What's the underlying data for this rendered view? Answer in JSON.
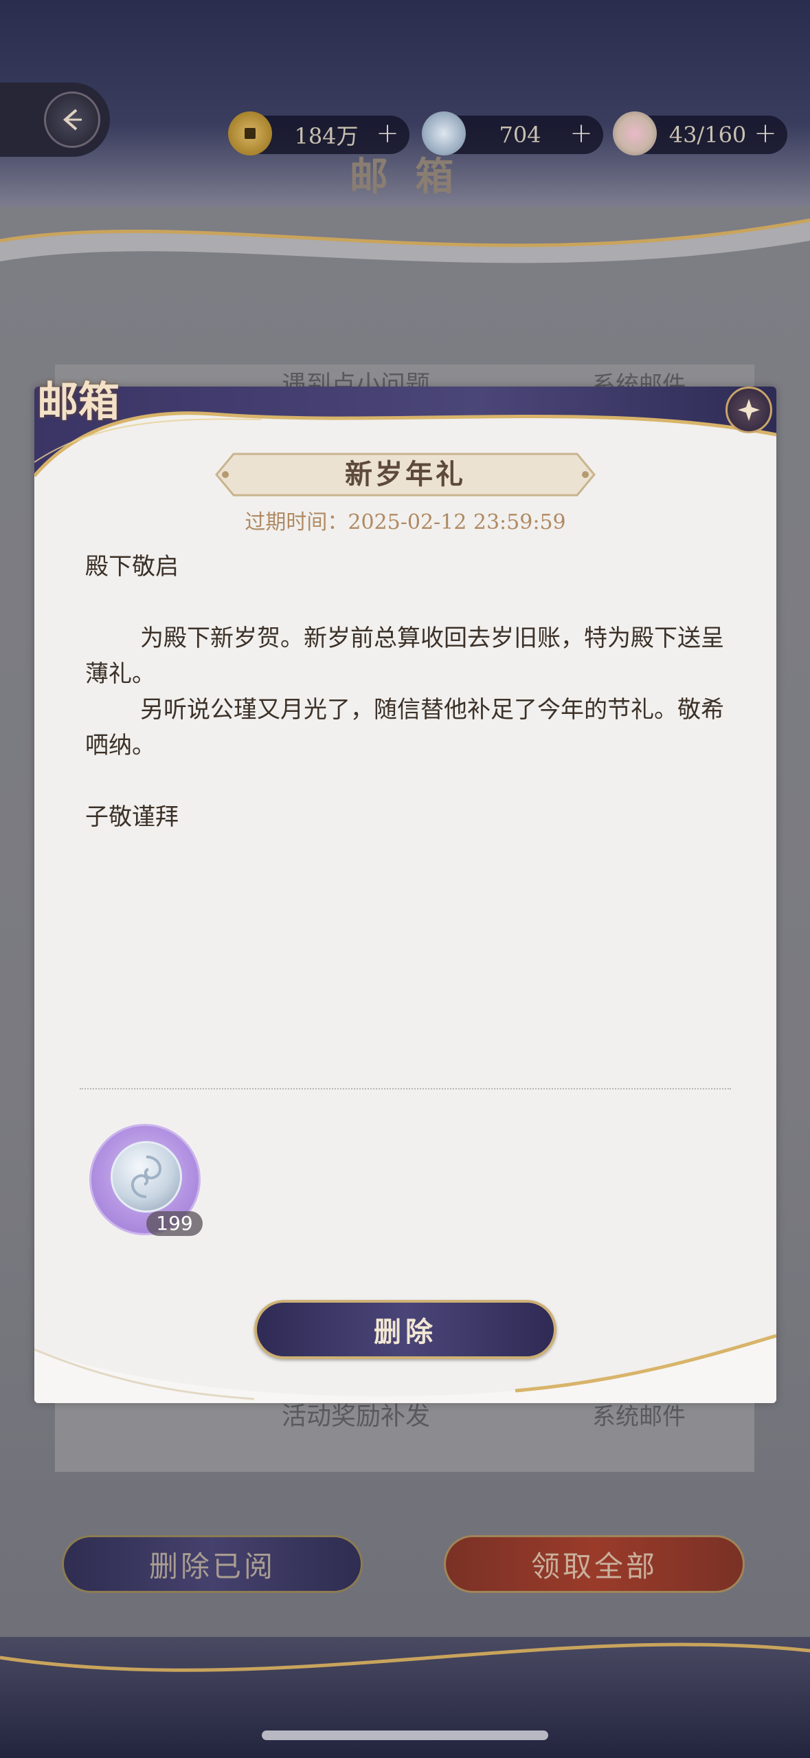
{
  "currencies": [
    {
      "icon": "coin-icon",
      "value": "184万",
      "plus": "+"
    },
    {
      "icon": "jade-icon",
      "value": "704",
      "plus": "+"
    },
    {
      "icon": "bowl-icon",
      "value": "43/160",
      "plus": "+"
    }
  ],
  "page_title": "邮 箱",
  "background_list": {
    "rows": [
      {
        "title": "遇到点小问题",
        "tag": "系统邮件"
      },
      {
        "title": "活动奖励补发",
        "tag": "系统邮件"
      }
    ]
  },
  "bottom_buttons": {
    "delete_read": "删除已阅",
    "claim_all": "领取全部"
  },
  "modal": {
    "tab_label": "邮箱",
    "mail_title": "新岁年礼",
    "expire": "过期时间：2025-02-12 23:59:59",
    "greeting": "殿下敬启",
    "paragraph1": "为殿下新岁贺。新岁前总算收回去岁旧账，特为殿下送呈薄礼。",
    "paragraph2": "另听说公瑾又月光了，随信替他补足了今年的节礼。敬希哂纳。",
    "signature": "子敬谨拜",
    "reward": {
      "icon": "jade-icon",
      "count": "199"
    },
    "delete_label": "删除"
  },
  "colors": {
    "accent_gold": "#cdb074",
    "button_purple": "#3d3868",
    "button_red": "#9a3b2a",
    "text_brown": "#3c3128",
    "expire_color": "#b08a63"
  }
}
